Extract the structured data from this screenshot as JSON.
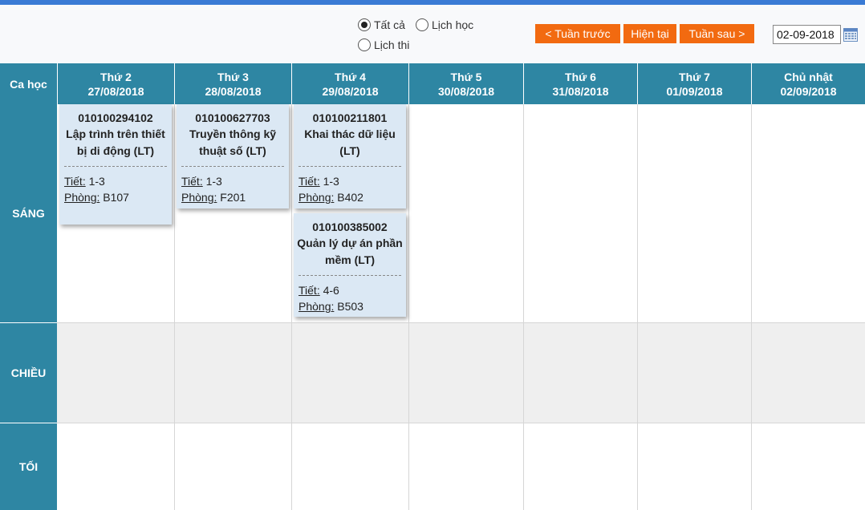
{
  "filter": {
    "options": [
      {
        "label": "Tất cả",
        "checked": true
      },
      {
        "label": "Lịch học",
        "checked": false
      },
      {
        "label": "Lịch thi",
        "checked": false
      }
    ]
  },
  "nav": {
    "prev_week": "< Tuần trước",
    "current": "Hiện tại",
    "next_week": "Tuần sau >"
  },
  "date_value": "02-09-2018",
  "table": {
    "corner_label": "Ca học",
    "days": [
      {
        "name": "Thứ 2",
        "date": "27/08/2018"
      },
      {
        "name": "Thứ 3",
        "date": "28/08/2018"
      },
      {
        "name": "Thứ 4",
        "date": "29/08/2018"
      },
      {
        "name": "Thứ 5",
        "date": "30/08/2018"
      },
      {
        "name": "Thứ 6",
        "date": "31/08/2018"
      },
      {
        "name": "Thứ 7",
        "date": "01/09/2018"
      },
      {
        "name": "Chủ nhật",
        "date": "02/09/2018"
      }
    ],
    "sessions": [
      "SÁNG",
      "CHIỀU",
      "TỐI"
    ]
  },
  "labels": {
    "period": "Tiết:",
    "room": "Phòng:"
  },
  "classes": [
    {
      "code": "010100294102",
      "name": "Lập trình trên thiết bị di động (LT)",
      "period": "1-3",
      "room": "B107"
    },
    {
      "code": "010100627703",
      "name": "Truyền thông kỹ thuật số (LT)",
      "period": "1-3",
      "room": "F201"
    },
    {
      "code": "010100211801",
      "name": "Khai thác dữ liệu (LT)",
      "period": "1-3",
      "room": "B402"
    },
    {
      "code": "010100385002",
      "name": "Quản lý dự án phần mềm (LT)",
      "period": "4-6",
      "room": "B503"
    }
  ],
  "colors": {
    "header": "#2e86a3",
    "accent_button": "#f26a10",
    "card": "#dbe8f4",
    "top_bar": "#3a7bd5"
  }
}
